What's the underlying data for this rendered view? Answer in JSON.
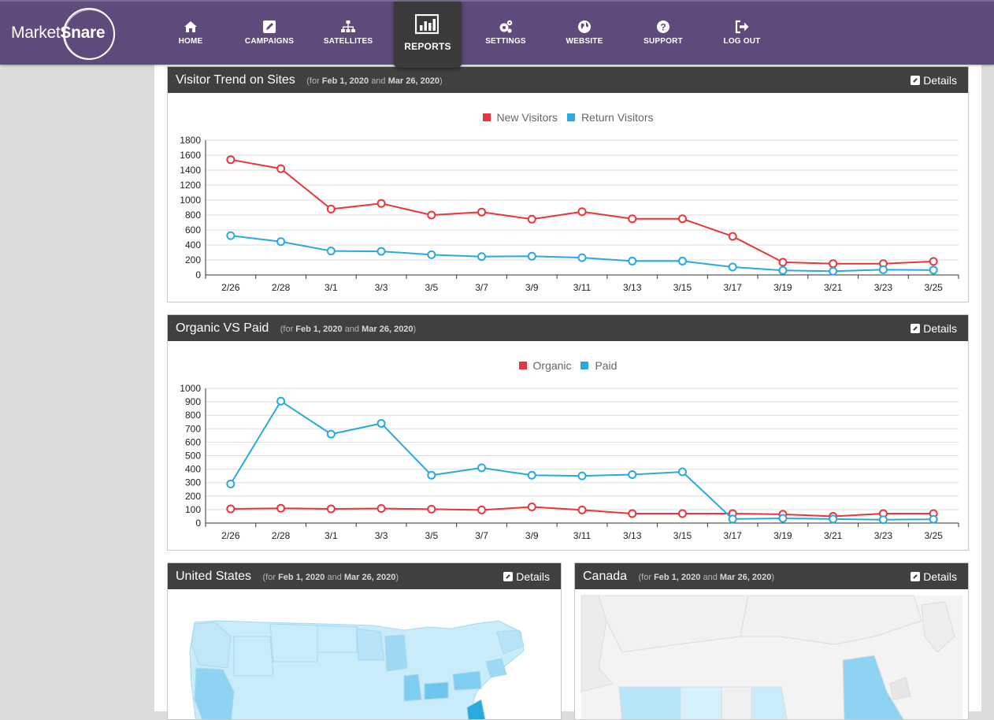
{
  "brand": {
    "market": "Market",
    "snare": "Snare"
  },
  "nav": [
    {
      "label": "HOME",
      "icon": "home-icon"
    },
    {
      "label": "CAMPAIGNS",
      "icon": "edit-icon"
    },
    {
      "label": "SATELLITES",
      "icon": "sitemap-icon"
    },
    {
      "label": "REPORTS",
      "icon": "bar-chart-icon",
      "active": true
    },
    {
      "label": "SETTINGS",
      "icon": "gears-icon"
    },
    {
      "label": "WEBSITE",
      "icon": "globe-icon"
    },
    {
      "label": "SUPPORT",
      "icon": "question-icon"
    },
    {
      "label": "LOG OUT",
      "icon": "sign-out-icon"
    }
  ],
  "colors": {
    "red": "#e8363c",
    "blue": "#29a9df",
    "nav_bg": "#5e4a7b",
    "panel_head": "#404040"
  },
  "range": {
    "prefix": "(for",
    "start": "Feb 1, 2020",
    "and": "and",
    "end": "Mar 26, 2020",
    "suffix": ")"
  },
  "details_label": "Details",
  "panels": {
    "visitor_trend": {
      "title": "Visitor Trend on Sites"
    },
    "organic_paid": {
      "title": "Organic VS Paid"
    },
    "united_states": {
      "title": "United States"
    },
    "canada": {
      "title": "Canada"
    }
  },
  "chart_data": [
    {
      "type": "line",
      "title": "Visitor Trend on Sites",
      "categories": [
        "2/26",
        "2/28",
        "3/1",
        "3/3",
        "3/5",
        "3/7",
        "3/9",
        "3/11",
        "3/13",
        "3/15",
        "3/17",
        "3/19",
        "3/21",
        "3/23",
        "3/25"
      ],
      "ylim": [
        0,
        1800
      ],
      "yticks": [
        0,
        200,
        400,
        600,
        800,
        1000,
        1200,
        1400,
        1600,
        1800
      ],
      "grid": true,
      "legend": "top-center",
      "series": [
        {
          "name": "New Visitors",
          "color": "#e8363c",
          "values": [
            1540,
            1420,
            880,
            955,
            800,
            840,
            745,
            845,
            750,
            750,
            515,
            170,
            150,
            150,
            180
          ]
        },
        {
          "name": "Return Visitors",
          "color": "#29a9df",
          "values": [
            525,
            445,
            320,
            315,
            270,
            245,
            250,
            230,
            185,
            185,
            105,
            60,
            50,
            70,
            65
          ]
        }
      ]
    },
    {
      "type": "line",
      "title": "Organic VS Paid",
      "categories": [
        "2/26",
        "2/28",
        "3/1",
        "3/3",
        "3/5",
        "3/7",
        "3/9",
        "3/11",
        "3/13",
        "3/15",
        "3/17",
        "3/19",
        "3/21",
        "3/23",
        "3/25"
      ],
      "ylim": [
        0,
        1000
      ],
      "yticks": [
        0,
        100,
        200,
        300,
        400,
        500,
        600,
        700,
        800,
        900,
        1000
      ],
      "grid": true,
      "legend": "top-center",
      "series": [
        {
          "name": "Organic",
          "color": "#e8363c",
          "values": [
            105,
            110,
            105,
            108,
            103,
            97,
            120,
            97,
            70,
            70,
            70,
            65,
            50,
            70,
            70
          ]
        },
        {
          "name": "Paid",
          "color": "#29a9df",
          "values": [
            290,
            905,
            660,
            740,
            355,
            410,
            355,
            350,
            360,
            380,
            30,
            35,
            30,
            25,
            28
          ]
        }
      ]
    }
  ]
}
